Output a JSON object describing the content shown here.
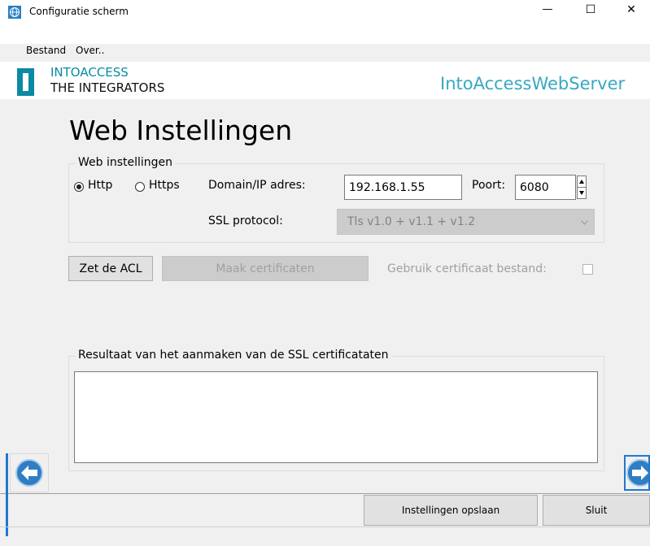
{
  "window": {
    "title": "Configuratie scherm",
    "minimize_glyph": "—",
    "maximize_glyph": "☐",
    "close_glyph": "✕"
  },
  "menu": {
    "items": [
      "Bestand",
      "Over.."
    ]
  },
  "header": {
    "brand_line1": "INTOACCESS",
    "brand_line2": "THE INTEGRATORS",
    "app_name": "IntoAccessWebServer"
  },
  "page": {
    "title": "Web Instellingen"
  },
  "web_settings": {
    "group_label": "Web instellingen",
    "protocol_options": [
      "Http",
      "Https"
    ],
    "selected_protocol": "Http",
    "domain_label": "Domain/IP adres:",
    "domain_value": "192.168.1.55",
    "port_label": "Poort:",
    "port_value": "6080",
    "ssl_label": "SSL protocol:",
    "ssl_value": "Tls v1.0 + v1.1 + v1.2"
  },
  "actions": {
    "acl_button": "Zet de ACL",
    "make_certs_button": "Maak certificaten",
    "use_cert_file_label": "Gebruik certificaat bestand:",
    "use_cert_file_checked": false
  },
  "result": {
    "group_label": "Resultaat van het aanmaken van de SSL certificataten",
    "text": ""
  },
  "footer": {
    "save_button": "Instellingen opslaan",
    "close_button": "Sluit"
  },
  "icons": {
    "app": "globe-icon",
    "back": "arrow-left-icon",
    "forward": "arrow-right-icon"
  },
  "colors": {
    "brand_teal": "#0a8aa5",
    "app_name": "#38a8c2",
    "nav_button": "#2f7ec4",
    "disabled_text": "#a0a0a0"
  }
}
